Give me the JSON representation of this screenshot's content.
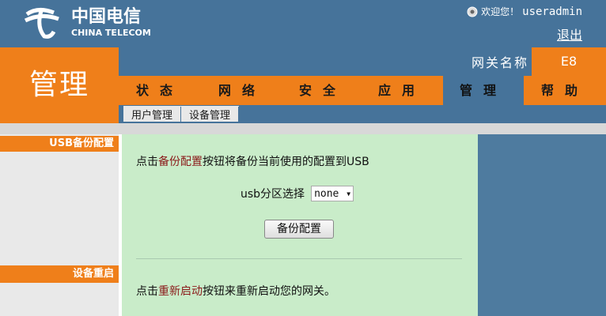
{
  "header": {
    "logo": {
      "cn": "中国电信",
      "en": "CHINA TELECOM"
    },
    "welcome": "欢迎您！",
    "username": "useradmin",
    "logout": "退出"
  },
  "page_title": "管理",
  "gateway": {
    "label": "网关名称",
    "value": "E8"
  },
  "nav": {
    "tabs": [
      {
        "label": "状态"
      },
      {
        "label": "网络"
      },
      {
        "label": "安全"
      },
      {
        "label": "应用"
      },
      {
        "label": "管理",
        "active": true
      },
      {
        "label": "帮助"
      }
    ]
  },
  "subnav": {
    "items": [
      "用户管理",
      "设备管理"
    ]
  },
  "sections": {
    "usb": {
      "title": "USB备份配置",
      "desc_pre": "点击",
      "desc_hl": "备份配置",
      "desc_post": "按钮将备份当前使用的配置到USB",
      "partition_label": "usb分区选择",
      "partition_value": "none",
      "button": "备份配置"
    },
    "restart": {
      "title": "设备重启",
      "desc_pre": "点击",
      "desc_hl": "重新启动",
      "desc_post": "按钮来重新启动您的网关。"
    }
  },
  "colors": {
    "orange": "#ef7f1a",
    "blue": "#46739a",
    "green": "#c9ecc9"
  }
}
